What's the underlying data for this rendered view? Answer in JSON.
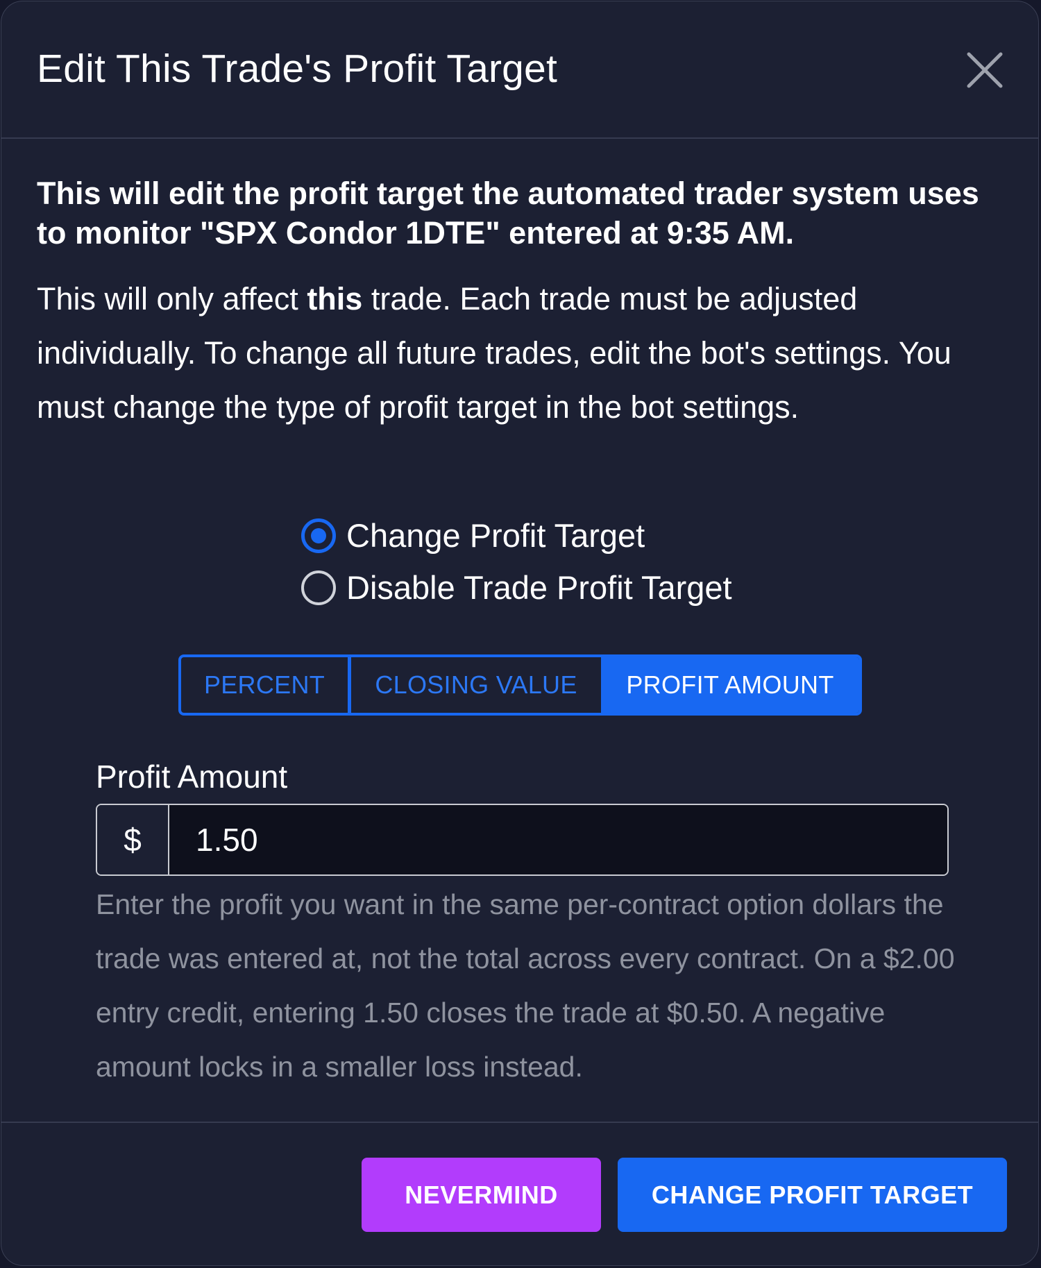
{
  "modal": {
    "title": "Edit This Trade's Profit Target",
    "close_icon": "close-icon"
  },
  "lead": "This will edit the profit target the automated trader system uses to monitor \"SPX Condor 1DTE\" entered at 9:35 AM.",
  "info": {
    "before": "This will only affect ",
    "emphasis": "this",
    "after": " trade. Each trade must be adjusted individually. To change all future trades, edit the bot's settings. You must change the type of profit target in the bot settings."
  },
  "radio_options": [
    {
      "label": "Change Profit Target",
      "checked": true
    },
    {
      "label": "Disable Trade Profit Target",
      "checked": false
    }
  ],
  "target_types": [
    {
      "label": "PERCENT",
      "selected": false
    },
    {
      "label": "CLOSING VALUE",
      "selected": false
    },
    {
      "label": "PROFIT AMOUNT",
      "selected": true
    }
  ],
  "field": {
    "label": "Profit Amount",
    "prefix": "$",
    "value": "1.50",
    "help": "Enter the profit you want in the same per-contract option dollars the trade was entered at, not the total across every contract. On a $2.00 entry credit, entering 1.50 closes the trade at $0.50. A negative amount locks in a smaller loss instead."
  },
  "footer": {
    "cancel_label": "NEVERMIND",
    "submit_label": "CHANGE PROFIT TARGET"
  },
  "colors": {
    "background": "#1c2033",
    "accent": "#1868f2",
    "cancel": "#b23cfc",
    "muted_text": "#8f939f"
  }
}
